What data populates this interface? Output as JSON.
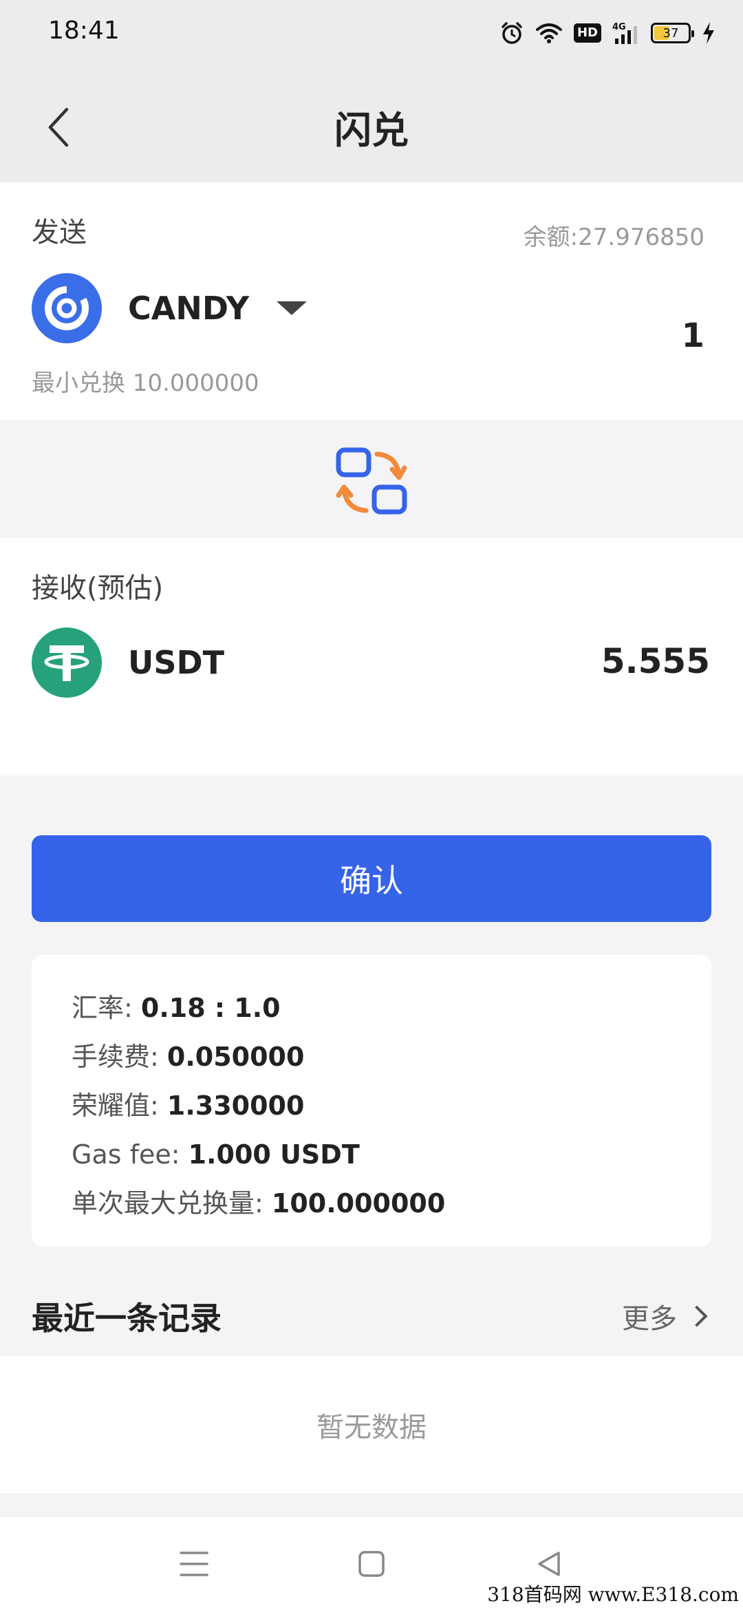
{
  "status_bar": {
    "time": "18:41",
    "battery": "37",
    "network": "4G",
    "hd": "HD"
  },
  "header": {
    "title": "闪兑"
  },
  "send": {
    "label": "发送",
    "balance": "余额:27.976850",
    "token": "CANDY",
    "amount": "1",
    "min_exchange": "最小兑换 10.000000"
  },
  "receive": {
    "label": "接收(预估)",
    "token": "USDT",
    "amount": "5.555"
  },
  "confirm_label": "确认",
  "info": {
    "rate_label": "汇率: ",
    "rate_value": "0.18 : 1.0",
    "fee_label": "手续费: ",
    "fee_value": "0.050000",
    "honor_label": "荣耀值: ",
    "honor_value": "1.330000",
    "gas_label": "Gas fee: ",
    "gas_value": "1.000 USDT",
    "max_label": "单次最大兑换量: ",
    "max_value": "100.000000"
  },
  "recent": {
    "title": "最近一条记录",
    "more": "更多",
    "empty": "暂无数据"
  },
  "watermark": "318首码网 www.E318.com",
  "colors": {
    "primary": "#3563e9",
    "candy_blue": "#3a6ee8",
    "usdt_green": "#26a17b",
    "swap_orange": "#f28a3a"
  },
  "icons": {
    "back": "chevron-left-icon",
    "dropdown": "caret-down-icon",
    "swap": "swap-icon",
    "more": "chevron-right-icon"
  }
}
